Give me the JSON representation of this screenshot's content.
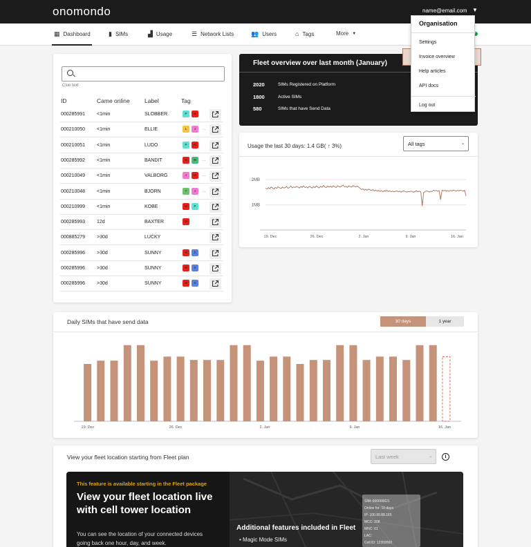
{
  "app": {
    "logo": "onomondo",
    "user_email": "name@email.com"
  },
  "nav": {
    "items": [
      {
        "label": "Dashboard"
      },
      {
        "label": "SIMs"
      },
      {
        "label": "Usage"
      },
      {
        "label": "Network Lists"
      },
      {
        "label": "Users"
      },
      {
        "label": "Tags"
      },
      {
        "label": "More"
      }
    ]
  },
  "sim_table": {
    "search_placeholder": "",
    "clue_text": "Clue text",
    "headers": [
      "ID",
      "Came online",
      "Label",
      "Tag"
    ],
    "rows": [
      {
        "id": "000285991",
        "online": "<1min",
        "label": "SLOBBER",
        "tags": [
          {
            "t": "P",
            "c": "#5fe0d0"
          },
          {
            "t": "W",
            "c": "#e8201a"
          }
        ]
      },
      {
        "id": "000210050",
        "online": "<1min",
        "label": "ELLIE",
        "tags": [
          {
            "t": "L",
            "c": "#f5c542"
          },
          {
            "t": "J",
            "c": "#f07bd0"
          },
          {
            "t": "...",
            "c": ""
          }
        ]
      },
      {
        "id": "000210051",
        "online": "<1min",
        "label": "LUDO",
        "tags": [
          {
            "t": "P",
            "c": "#5fe0d0"
          },
          {
            "t": "W",
            "c": "#e8201a"
          }
        ]
      },
      {
        "id": "000285992",
        "online": "<1min",
        "label": "BANDIT",
        "tags": [
          {
            "t": "W",
            "c": "#e8201a"
          },
          {
            "t": "W",
            "c": "#4fb87a"
          },
          {
            "t": "...",
            "c": ""
          }
        ]
      },
      {
        "id": "000210049",
        "online": "<1min",
        "label": "VALBORG",
        "tags": [
          {
            "t": "J",
            "c": "#f07bd0"
          },
          {
            "t": "W",
            "c": "#e8201a"
          },
          {
            "t": "...",
            "c": ""
          }
        ]
      },
      {
        "id": "000210048",
        "online": "<1min",
        "label": "BJORN",
        "tags": [
          {
            "t": "T",
            "c": "#6cc36a"
          },
          {
            "t": "J",
            "c": "#f07bd0"
          },
          {
            "t": "...",
            "c": ""
          }
        ]
      },
      {
        "id": "000210999",
        "online": "<1min",
        "label": "KOBE",
        "tags": [
          {
            "t": "W",
            "c": "#e8201a"
          },
          {
            "t": "P",
            "c": "#5fe0d0"
          }
        ]
      },
      {
        "id": "000285993",
        "online": "12d",
        "label": "BAXTER",
        "tags": [
          {
            "t": "W",
            "c": "#e8201a"
          }
        ]
      },
      {
        "id": "000885279",
        "online": ">30d",
        "label": "LUCKY",
        "tags": []
      },
      {
        "id": "000285996",
        "online": ">30d",
        "label": "SUNNY",
        "tags": [
          {
            "t": "W",
            "c": "#e8201a"
          },
          {
            "t": "S",
            "c": "#5b7fdd"
          }
        ]
      },
      {
        "id": "000285996",
        "online": ">30d",
        "label": "SUNNY",
        "tags": [
          {
            "t": "W",
            "c": "#e8201a"
          },
          {
            "t": "S",
            "c": "#5b7fdd"
          }
        ]
      },
      {
        "id": "000285996",
        "online": ">30d",
        "label": "SUNNY",
        "tags": [
          {
            "t": "W",
            "c": "#e8201a"
          },
          {
            "t": "S",
            "c": "#5b7fdd"
          }
        ]
      }
    ]
  },
  "fleet_overview": {
    "title": "Fleet overview over last month (January)",
    "stats": [
      {
        "num": "2020",
        "label": "SIMs Registered on Platform"
      },
      {
        "num": "1800",
        "label": "Active SIMs"
      },
      {
        "num": "580",
        "label": "SIMs that have Send Data"
      }
    ]
  },
  "dropdown": {
    "heading": "Organisation",
    "items": [
      "Settings",
      "Invoice overview",
      "Help articles",
      "API docs",
      "Log out"
    ],
    "highlighted": "Invoice overview"
  },
  "usage": {
    "title": "Usage the last 30 days: 1.4 GB( ↑ 3%)",
    "filter_value": "All tags"
  },
  "daily": {
    "title": "Daily  SIMs that have send data",
    "toggle": [
      "30 days",
      "1 year"
    ],
    "active_toggle": "30 days"
  },
  "location": {
    "title": "View your fleet location starting from Fleet plan",
    "period_value": "Last week",
    "promo_kicker": "This feature is available starting in the Fleet package",
    "promo_heading": "View your fleet location live with cell tower location",
    "promo_text": "You can see the location of your connected devices going back one hour, day, and week.",
    "features_heading": "Additional features included in Fleet",
    "feature_1": "•  Magic Mode SIMs",
    "tower_info": [
      "SIM: 000000021",
      "Online for: 10 days",
      "IP: 100.99.88.165",
      "MCC: 208",
      "MNC: 01",
      "LAC:",
      "Cell ID: 12359060"
    ]
  },
  "colors": {
    "accent": "#c5927a",
    "dark": "#1b1b1b",
    "online": "#1c9c4a"
  },
  "chart_data": [
    {
      "type": "line",
      "title": "Usage the last 30 days: 1.4 GB( ↑ 3%)",
      "x_ticks": [
        "19. Dec",
        "26. Dec",
        "2. Jan",
        "9. Jan",
        "16. Jan"
      ],
      "y_ticks": [
        "2MB",
        "1MB"
      ],
      "series": [
        {
          "values": [
            1.66,
            1.62,
            1.68,
            1.64,
            1.7,
            1.66,
            1.63,
            1.69,
            1.65,
            1.71,
            1.67,
            1.64,
            1.7,
            1.66,
            1.68,
            1.72,
            1.65,
            1.69,
            1.74,
            1.67,
            1.71,
            1.68,
            1.73,
            1.7,
            1.66,
            1.72,
            1.69,
            1.75,
            1.68,
            1.71,
            1.67,
            1.73,
            1.7,
            1.66,
            1.72,
            1.68,
            1.74,
            1.7,
            1.67,
            1.73,
            1.69,
            1.76,
            1.71,
            1.68,
            1.74,
            1.7,
            1.73,
            1.69,
            1.75,
            1.71,
            1.68,
            1.76,
            1.72,
            1.7,
            1.74,
            1.78,
            1.71,
            1.73,
            1.69,
            1.75,
            1.72,
            1.7,
            1.76,
            1.73,
            1.71,
            1.74,
            1.7,
            1.65,
            1.6,
            1.63,
            1.58,
            1.61,
            1.57,
            1.62,
            1.59,
            1.56,
            1.6,
            1.55,
            1.58,
            1.54,
            1.57,
            1.53,
            1.56,
            1.52,
            1.55,
            1.54,
            1.56,
            1.53,
            1.55,
            1.52,
            1.54,
            1.51,
            1.53,
            1.55,
            1.52,
            1.54,
            1.5,
            1.53,
            1.55,
            1.52,
            1.5,
            1.53,
            1.51,
            1.54,
            1.52,
            1.5,
            1.53,
            1.55,
            1.52,
            1.54,
            1.51,
            0.95,
            1.48,
            1.52,
            1.55,
            1.53,
            1.5,
            1.54,
            1.52,
            1.58,
            1.55,
            1.57,
            1.53,
            1.56,
            1.2,
            1.58,
            1.55,
            1.57,
            1.54,
            1.56,
            1.53,
            1.57,
            1.55,
            1.58,
            1.56,
            1.54,
            1.57,
            1.55,
            1.58,
            1.56,
            1.54,
            1.57,
            1.35
          ]
        }
      ],
      "ylim": [
        0,
        2.6
      ]
    },
    {
      "type": "bar",
      "title": "Daily  SIMs that have send data",
      "x_ticks": [
        "19. Dec",
        "26. Dec",
        "2. Jan",
        "9. Jan",
        "16. Jan"
      ],
      "values": [
        85,
        90,
        90,
        113,
        113,
        90,
        96,
        96,
        91,
        91,
        91,
        113,
        113,
        90,
        96,
        96,
        85,
        91,
        91,
        113,
        113,
        91,
        96,
        96,
        91,
        113,
        113,
        96
      ],
      "last_bar_dashed": true,
      "ylim": [
        0,
        125
      ]
    }
  ]
}
